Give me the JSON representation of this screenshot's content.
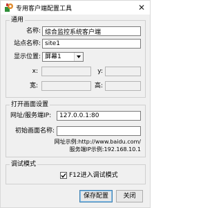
{
  "window": {
    "title": "专用客户端配置工具",
    "close_glyph": "✕",
    "icon": "app-icon"
  },
  "general": {
    "group_title": "通用",
    "name_label": "名称:",
    "name_value": "综合监控系统客户端",
    "site_label": "站点名称:",
    "site_value": "site1",
    "display_label": "显示位置:",
    "display_value": "屏幕1",
    "x_label": "x:",
    "y_label": "y:",
    "width_label": "宽:",
    "height_label": "高:"
  },
  "open_screen": {
    "group_title": "打开画面设置",
    "url_label": "网址/服务端IP:",
    "url_value": "127.0.0.1:80",
    "initial_label": "初始画面名称:",
    "initial_value": "",
    "example_url": "网址示例:http://www.baidu.com/",
    "example_ip": "服务端IP示例:192.168.10.1"
  },
  "debug": {
    "group_title": "调试模式",
    "f12_label": "F12进入调试模式",
    "f12_checked": true
  },
  "buttons": {
    "save_label": "保存配置",
    "close_label": "关闭"
  }
}
